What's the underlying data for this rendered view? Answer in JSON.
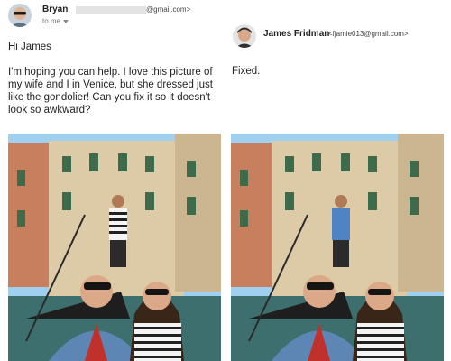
{
  "original_email": {
    "sender_name": "Bryan",
    "sender_email_suffix": "@gmail.com>",
    "recipient_label": "to me",
    "greeting": "Hi James",
    "body": "I'm hoping you can help. I love this picture of my wife and I in Venice, but she dressed just like the gondolier! Can you fix it so it doesn't look so awkward?"
  },
  "reply": {
    "sender_name": "James Fridman",
    "sender_email": "<fjamie013@gmail.com>",
    "body": "Fixed."
  },
  "photos": {
    "original_gondolier_shirt": "striped",
    "edited_gondolier_shirt": "blue",
    "colors": {
      "sky": "#9fd0ef",
      "wall": "#d9c7a3",
      "shutters": "#3f6b4d",
      "water": "#3c6f6e",
      "blue_shirt": "#4f84c4",
      "stripe_dark": "#222222"
    }
  }
}
